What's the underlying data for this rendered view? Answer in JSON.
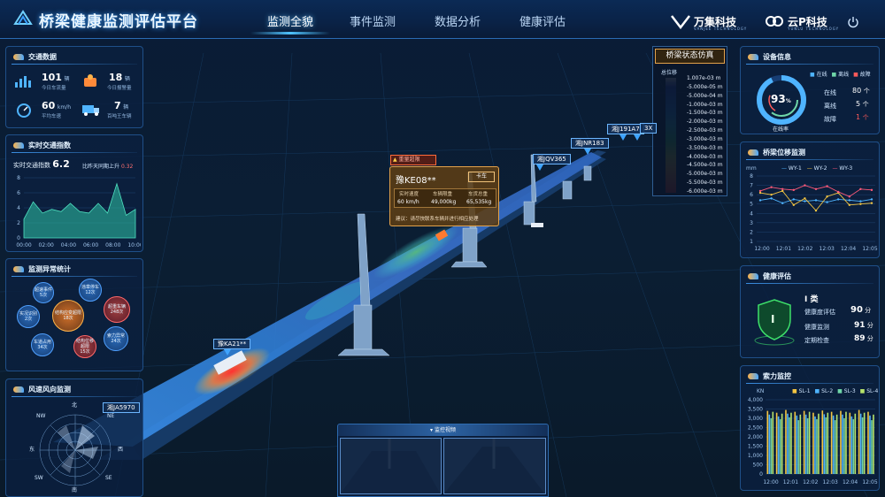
{
  "header": {
    "title": "桥梁健康监测评估平台",
    "nav": [
      "监测全貌",
      "事件监测",
      "数据分析",
      "健康评估"
    ],
    "active_nav": 0,
    "brand1": "万集科技",
    "brand1_sub": "VANJEE TECHNOLOGY",
    "brand2": "云P科技",
    "brand2_sub": "YUNLU TECHNOLOGY"
  },
  "traffic": {
    "title": "交通数据",
    "items": [
      {
        "value": "101",
        "unit": "辆",
        "label": "今日车流量"
      },
      {
        "value": "18",
        "unit": "辆",
        "label": "今日报警量"
      },
      {
        "value": "60",
        "unit": "km/h",
        "label": "平均车速"
      },
      {
        "value": "7",
        "unit": "辆",
        "label": "百吨王车辆"
      }
    ]
  },
  "index": {
    "title": "实时交通指数",
    "label": "实时交通指数",
    "value": "6.2",
    "compare_label": "比昨天同期上升",
    "compare_value": "0.32"
  },
  "index_chart": {
    "type": "area",
    "x": [
      "00:00",
      "02:00",
      "04:00",
      "06:00",
      "08:00",
      "10:00"
    ],
    "y": [
      2.5,
      4.8,
      3.3,
      3.8,
      3.5,
      4.6,
      3.5,
      3.3,
      4.6,
      3.3,
      7.2,
      3.0,
      3.8
    ],
    "ylim": [
      0,
      8
    ],
    "yticks": [
      0,
      2,
      4,
      6,
      8
    ]
  },
  "anomaly": {
    "title": "监测异常统计",
    "bubbles": [
      {
        "label": "超速事件",
        "value": "5次"
      },
      {
        "label": "违章停车",
        "value": "12次"
      },
      {
        "label": "实况识别",
        "value": "2次"
      },
      {
        "label": "结构应变超限",
        "value": "18次"
      },
      {
        "label": "超重车辆",
        "value": "248次"
      },
      {
        "label": "车道占用",
        "value": "34次"
      },
      {
        "label": "结构位移超限",
        "value": "15次"
      },
      {
        "label": "索力异常",
        "value": "24次"
      }
    ]
  },
  "wind": {
    "title": "风速风向监测",
    "dirs": {
      "n": "北",
      "ne": "NE",
      "e": "西",
      "se": "SE",
      "s": "南",
      "sw": "SW",
      "w": "东",
      "nw": "NW"
    }
  },
  "device": {
    "title": "设备信息",
    "legend": [
      "在线",
      "离线",
      "故障"
    ],
    "percent": "93",
    "percent_unit": "%",
    "rate_label": "在线率",
    "rows": [
      {
        "label": "在线",
        "value": "80",
        "unit": "个"
      },
      {
        "label": "离线",
        "value": "5",
        "unit": "个"
      },
      {
        "label": "故障",
        "value": "1",
        "unit": "个"
      }
    ]
  },
  "disp": {
    "title": "桥梁位移监测",
    "unit": "mm",
    "series_names": [
      "WY-1",
      "WY-2",
      "WY-3"
    ]
  },
  "disp_chart": {
    "type": "line",
    "x": [
      "12:00",
      "12:01",
      "12:02",
      "12:03",
      "12:04",
      "12:05"
    ],
    "ylim": [
      1,
      8
    ],
    "yticks": [
      1,
      2,
      3,
      4,
      5,
      6,
      7,
      8
    ],
    "series": [
      {
        "name": "WY-1",
        "color": "#4fb4ff",
        "values": [
          5.4,
          5.6,
          5.1,
          5.5,
          5.3,
          5.4,
          5.2,
          5.5,
          5.4,
          5.3,
          5.5
        ]
      },
      {
        "name": "WY-2",
        "color": "#f4c542",
        "values": [
          6.2,
          6.0,
          6.4,
          4.9,
          5.6,
          4.3,
          5.8,
          6.2,
          4.9,
          5.0,
          5.1
        ]
      },
      {
        "name": "WY-3",
        "color": "#ff5a7a",
        "values": [
          6.4,
          6.8,
          6.6,
          6.5,
          7.0,
          6.6,
          6.9,
          6.3,
          5.8,
          6.6,
          6.5
        ]
      }
    ]
  },
  "health": {
    "title": "健康评估",
    "grade": "I 类",
    "badge": "I",
    "rows": [
      {
        "label": "健康度评估",
        "value": "90",
        "unit": "分"
      },
      {
        "label": "健康监测",
        "value": "91",
        "unit": "分"
      },
      {
        "label": "定期检查",
        "value": "89",
        "unit": "分"
      }
    ]
  },
  "cable": {
    "title": "索力监控",
    "unit": "KN",
    "series_names": [
      "SL-1",
      "SL-2",
      "SL-3",
      "SL-4"
    ]
  },
  "cable_chart": {
    "type": "bar",
    "x": [
      "12:00",
      "12:01",
      "12:02",
      "12:03",
      "12:04",
      "12:05"
    ],
    "ylim": [
      0,
      4000
    ],
    "yticks": [
      0,
      500,
      1000,
      1500,
      2000,
      2500,
      3000,
      3500,
      4000
    ],
    "series": [
      {
        "name": "SL-1",
        "color": "#f4c542",
        "values": [
          3400,
          3300,
          3450,
          3350,
          3400,
          3300,
          3420,
          3350,
          3400,
          3300,
          3450,
          3350
        ]
      },
      {
        "name": "SL-2",
        "color": "#4fb4ff",
        "values": [
          3200,
          3100,
          3250,
          3150,
          3200,
          3100,
          3220,
          3150,
          3200,
          3100,
          3250,
          3150
        ]
      },
      {
        "name": "SL-3",
        "color": "#6fd6a8",
        "values": [
          3000,
          2950,
          3050,
          2900,
          3000,
          2950,
          3050,
          2900,
          3000,
          2950,
          3050,
          2900
        ]
      },
      {
        "name": "SL-4",
        "color": "#b6e36b",
        "values": [
          3350,
          3250,
          3300,
          3200,
          3350,
          3250,
          3300,
          3200,
          3350,
          3250,
          3300,
          3200
        ]
      }
    ]
  },
  "sim": {
    "title": "桥梁状态仿真",
    "subtitle": "总位移",
    "ticks": [
      "1.007e-03 m",
      "-5.000e-05 m",
      "-5.000e-04 m",
      "-1.000e-03 m",
      "-1.500e-03 m",
      "-2.000e-03 m",
      "-2.500e-03 m",
      "-3.000e-03 m",
      "-3.500e-03 m",
      "-4.000e-03 m",
      "-4.500e-03 m",
      "-5.000e-03 m",
      "-5.500e-03 m",
      "-6.000e-03 m"
    ]
  },
  "popup": {
    "badge": "重量超限",
    "plate": "豫KE08**",
    "type": "卡车",
    "cols": [
      {
        "label": "实时速度",
        "value": "60 km/h"
      },
      {
        "label": "车辆限重",
        "value": "49,000kg"
      },
      {
        "label": "车货总重",
        "value": "65,535kg"
      }
    ],
    "suggest": "建议：请尽快联系车辆并进行相应处理"
  },
  "plates": {
    "p1": "豫KA21**",
    "p2": "湘JQV365",
    "p3": "湘JNR183",
    "p4": "湘J191A7",
    "p5": "3X",
    "p6": "湘JA5970"
  },
  "video": {
    "title": "监控视频"
  }
}
